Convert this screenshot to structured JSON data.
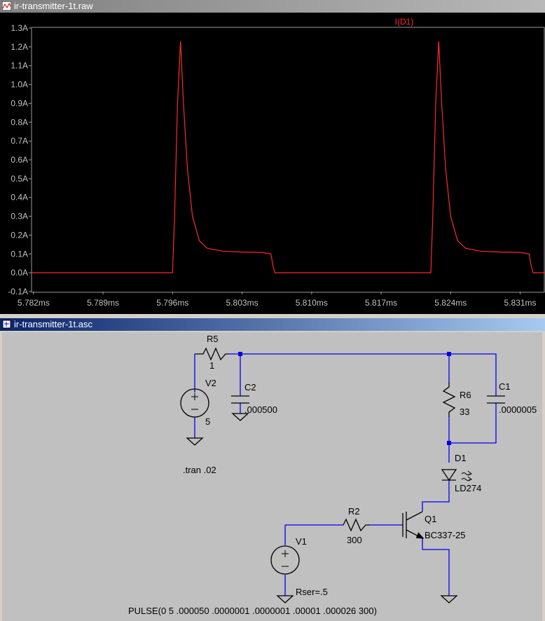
{
  "waveform_window": {
    "title": "ir-transmitter-1t.raw"
  },
  "schematic_window": {
    "title": "ir-transmitter-1t.asc"
  },
  "chart_data": {
    "type": "line",
    "title": "",
    "series": [
      {
        "name": "I(D1)",
        "color": "#ff2a2a"
      }
    ],
    "y_ticks": [
      "1.3A",
      "1.2A",
      "1.1A",
      "1.0A",
      "0.9A",
      "0.8A",
      "0.7A",
      "0.6A",
      "0.5A",
      "0.4A",
      "0.3A",
      "0.2A",
      "0.1A",
      "0.0A",
      "-0.1A"
    ],
    "x_ticks": [
      "5.782ms",
      "5.789ms",
      "5.796ms",
      "5.803ms",
      "5.810ms",
      "5.817ms",
      "5.824ms",
      "5.831ms"
    ],
    "ylim": [
      -0.1,
      1.3
    ],
    "xlim": [
      5.7818,
      5.8335
    ],
    "x_unit": "ms",
    "y_unit": "A",
    "points": [
      [
        5.7818,
        0.0
      ],
      [
        5.796,
        0.0
      ],
      [
        5.7962,
        0.3
      ],
      [
        5.7965,
        0.9
      ],
      [
        5.7968,
        1.23
      ],
      [
        5.7971,
        0.9
      ],
      [
        5.7975,
        0.55
      ],
      [
        5.798,
        0.3
      ],
      [
        5.7987,
        0.17
      ],
      [
        5.7995,
        0.13
      ],
      [
        5.801,
        0.115
      ],
      [
        5.803,
        0.11
      ],
      [
        5.805,
        0.108
      ],
      [
        5.8059,
        0.1
      ],
      [
        5.8061,
        0.04
      ],
      [
        5.8063,
        0.0
      ],
      [
        5.822,
        0.0
      ],
      [
        5.8222,
        0.3
      ],
      [
        5.8225,
        0.9
      ],
      [
        5.8228,
        1.23
      ],
      [
        5.8231,
        0.9
      ],
      [
        5.8235,
        0.55
      ],
      [
        5.824,
        0.3
      ],
      [
        5.8247,
        0.17
      ],
      [
        5.8255,
        0.13
      ],
      [
        5.827,
        0.115
      ],
      [
        5.829,
        0.11
      ],
      [
        5.831,
        0.108
      ],
      [
        5.8319,
        0.1
      ],
      [
        5.8321,
        0.04
      ],
      [
        5.8323,
        0.0
      ],
      [
        5.8335,
        0.0
      ]
    ],
    "grid": false
  },
  "schematic": {
    "R5": {
      "name": "R5",
      "value": "1"
    },
    "C2": {
      "name": "C2",
      "value": ".000500"
    },
    "V2": {
      "name": "V2",
      "value": "5"
    },
    "R6": {
      "name": "R6",
      "value": "33"
    },
    "C1": {
      "name": "C1",
      "value": ".0000005"
    },
    "D1": {
      "name": "D1",
      "value": "LD274"
    },
    "Q1": {
      "name": "Q1",
      "value": "BC337-25"
    },
    "R2": {
      "name": "R2",
      "value": "300"
    },
    "V1": {
      "name": "V1",
      "value": "Rser=.5"
    },
    "tran": ".tran .02",
    "pulse": "PULSE(0 5 .000050 .0000001 .0000001 .00001 .000026 300)"
  }
}
